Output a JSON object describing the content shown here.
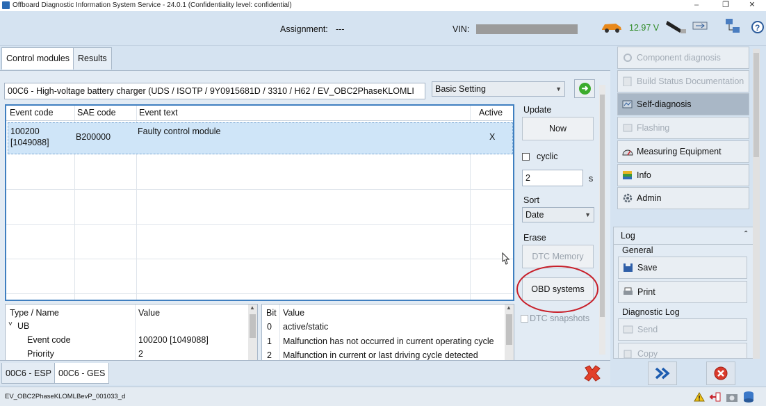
{
  "window": {
    "title": "Offboard Diagnostic Information System Service - 24.0.1 (Confidentiality level: confidential)",
    "controls": [
      "–",
      "❐",
      "✕"
    ]
  },
  "header": {
    "assignment_label": "Assignment:",
    "assignment_value": "---",
    "vin_label": "VIN:",
    "voltage": "12.97 V"
  },
  "tabs": [
    {
      "label": "Control modules"
    },
    {
      "label": "Results"
    }
  ],
  "module": {
    "name": "00C6 - High-voltage battery charger  (UDS / ISOTP / 9Y0915681D / 3310 / H62 / EV_OBC2PhaseKLOMLI",
    "function_selected": "Basic Setting"
  },
  "event_table": {
    "columns": [
      "Event code",
      "SAE code",
      "Event text",
      "Active"
    ],
    "rows": [
      {
        "event_code": "100200",
        "event_code_dec": "[1049088]",
        "sae_code": "B200000",
        "event_text": "Faulty control module",
        "active": "X"
      }
    ]
  },
  "controls": {
    "update_label": "Update",
    "now_label": "Now",
    "cyclic_label": "cyclic",
    "interval_value": "2",
    "interval_unit": "s",
    "sort_label": "Sort",
    "sort_value": "Date",
    "erase_label": "Erase",
    "dtc_memory_label": "DTC Memory",
    "obd_systems_label": "OBD systems",
    "dtc_snapshots_label": "DTC snapshots"
  },
  "properties": {
    "columns": [
      "Type / Name",
      "Value"
    ],
    "group": "UB",
    "rows": [
      {
        "name": "Event code",
        "value": "100200 [1049088]"
      },
      {
        "name": "Priority",
        "value": "2"
      }
    ]
  },
  "bits": {
    "columns": [
      "Bit",
      "Value"
    ],
    "rows": [
      {
        "bit": "0",
        "value": "active/static"
      },
      {
        "bit": "1",
        "value": "Malfunction has not occurred in current operating cycle"
      },
      {
        "bit": "2",
        "value": "Malfunction in current or last driving cycle detected"
      }
    ]
  },
  "bottom_tabs": [
    {
      "label": "00C6 - ESP"
    },
    {
      "label": "00C6 - GES"
    }
  ],
  "status": {
    "text": "EV_OBC2PhaseKLOMLBevP_001033_d"
  },
  "sidebar": {
    "items": [
      {
        "label": "Component diagnosis",
        "enabled": false
      },
      {
        "label": "Build Status Documentation",
        "enabled": false
      },
      {
        "label": "Self-diagnosis",
        "enabled": true,
        "selected": true
      },
      {
        "label": "Flashing",
        "enabled": false
      },
      {
        "label": "Measuring Equipment",
        "enabled": true
      },
      {
        "label": "Info",
        "enabled": true
      },
      {
        "label": "Admin",
        "enabled": true
      }
    ],
    "log": {
      "title": "Log",
      "general_label": "General",
      "save_label": "Save",
      "print_label": "Print",
      "diag_log_label": "Diagnostic Log",
      "send_label": "Send",
      "copy_label": "Copy"
    }
  },
  "colors": {
    "background": "#d5e3f1",
    "panel": "#e2ebf4",
    "selection": "#cfe5f8",
    "table_border": "#3f7fc0",
    "voltage": "#2d8a24",
    "annotation": "#c8202a",
    "selected_nav": "#a9b7c6"
  }
}
